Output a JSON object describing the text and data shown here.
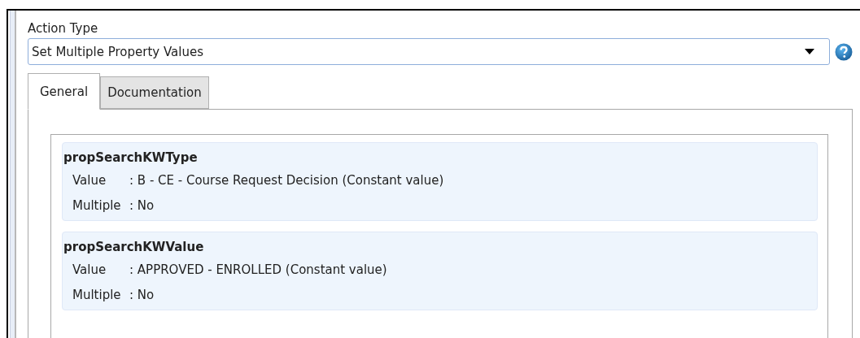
{
  "action_type": {
    "label": "Action Type",
    "value": "Set Multiple Property Values"
  },
  "tabs": [
    {
      "label": "General",
      "selected": true
    },
    {
      "label": "Documentation",
      "selected": false
    }
  ],
  "properties": [
    {
      "name": "propSearchKWType",
      "fields": [
        {
          "label": "Value",
          "value": ": B - CE - Course Request Decision (Constant value)"
        },
        {
          "label": "Multiple",
          "value": ": No"
        }
      ]
    },
    {
      "name": "propSearchKWValue",
      "fields": [
        {
          "label": "Value",
          "value": ": APPROVED - ENROLLED (Constant value)"
        },
        {
          "label": "Multiple",
          "value": ": No"
        }
      ]
    }
  ]
}
